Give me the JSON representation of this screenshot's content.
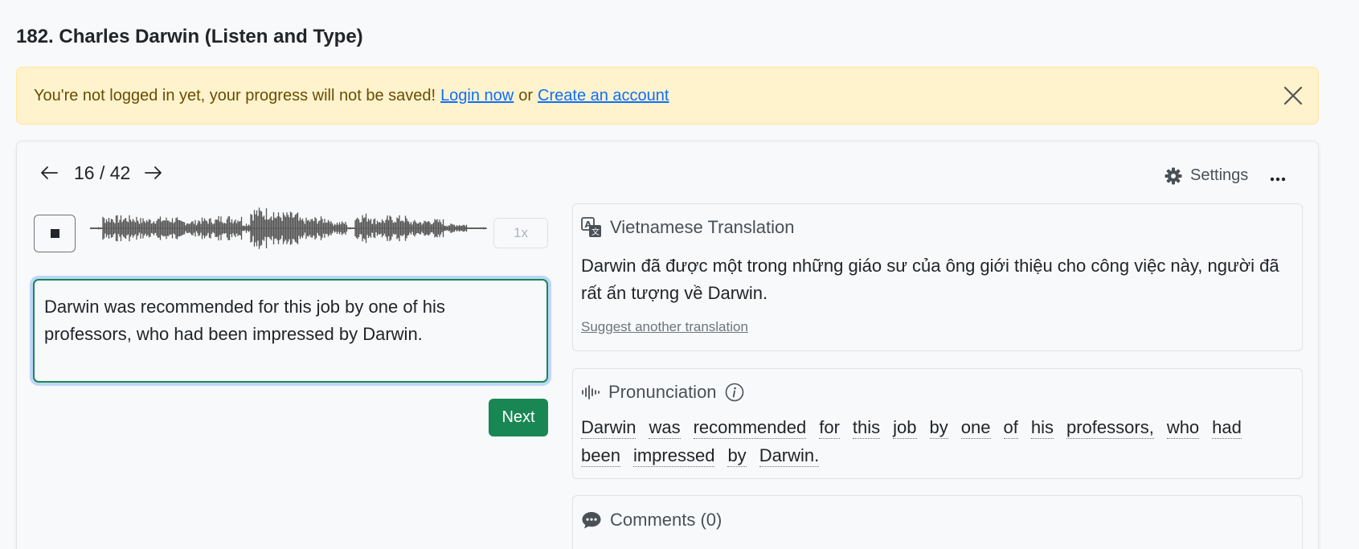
{
  "page": {
    "title": "182. Charles Darwin (Listen and Type)"
  },
  "alert": {
    "message": "You're not logged in yet, your progress will not be saved!",
    "login_link": "Login now",
    "or_text": "or",
    "create_link": "Create an account"
  },
  "player": {
    "counter": "16 / 42",
    "settings_label": "Settings",
    "speed": "1x"
  },
  "answer": {
    "value": "Darwin was recommended for this job by one of his professors, who had been impressed by Darwin."
  },
  "next_label": "Next",
  "translation": {
    "title": "Vietnamese Translation",
    "text": "Darwin đã được một trong những giáo sư của ông giới thiệu cho công việc này, người đã rất ấn tượng về Darwin.",
    "suggest_link": "Suggest another translation"
  },
  "pronunciation": {
    "title": "Pronunciation",
    "words": [
      "Darwin",
      "was",
      "recommended",
      "for",
      "this",
      "job",
      "by",
      "one",
      "of",
      "his",
      "professors,",
      "who",
      "had",
      "been",
      "impressed",
      "by",
      "Darwin."
    ]
  },
  "comments": {
    "title": "Comments (0)"
  },
  "colors": {
    "accent_green": "#198754",
    "alert_bg": "#fff3cd",
    "link_blue": "#0d6efd"
  },
  "icons": {
    "back": "arrow-left-icon",
    "forward": "arrow-right-icon",
    "settings": "gear-icon",
    "more": "ellipsis-icon",
    "stop": "stop-icon",
    "close": "close-icon",
    "translate": "translate-icon",
    "audio": "soundwave-icon",
    "info": "info-icon",
    "comment": "chat-icon"
  }
}
